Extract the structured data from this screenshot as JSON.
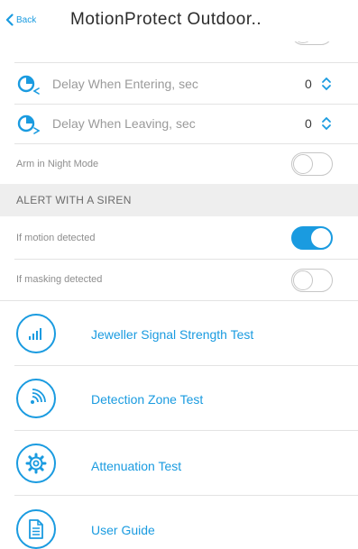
{
  "header": {
    "back_label": "Back",
    "title": "MotionProtect Outdoor.."
  },
  "delays": [
    {
      "label": "Delay When Entering, sec",
      "value": "0",
      "icon": "timer-enter-icon"
    },
    {
      "label": "Delay When Leaving, sec",
      "value": "0",
      "icon": "timer-leave-icon"
    }
  ],
  "night_mode": {
    "label": "Arm in Night Mode",
    "enabled": false
  },
  "siren_section": {
    "title": "ALERT WITH A SIREN",
    "items": [
      {
        "label": "If motion detected",
        "enabled": true
      },
      {
        "label": "If masking detected",
        "enabled": false
      }
    ]
  },
  "tests": [
    {
      "label": "Jeweller Signal Strength Test",
      "icon": "signal-bars-icon"
    },
    {
      "label": "Detection Zone Test",
      "icon": "detection-waves-icon"
    },
    {
      "label": "Attenuation Test",
      "icon": "gear-icon"
    },
    {
      "label": "User Guide",
      "icon": "document-icon"
    }
  ],
  "colors": {
    "accent": "#1a9be0",
    "section_bg": "#eeeeee",
    "divider": "#e3e3e3"
  }
}
